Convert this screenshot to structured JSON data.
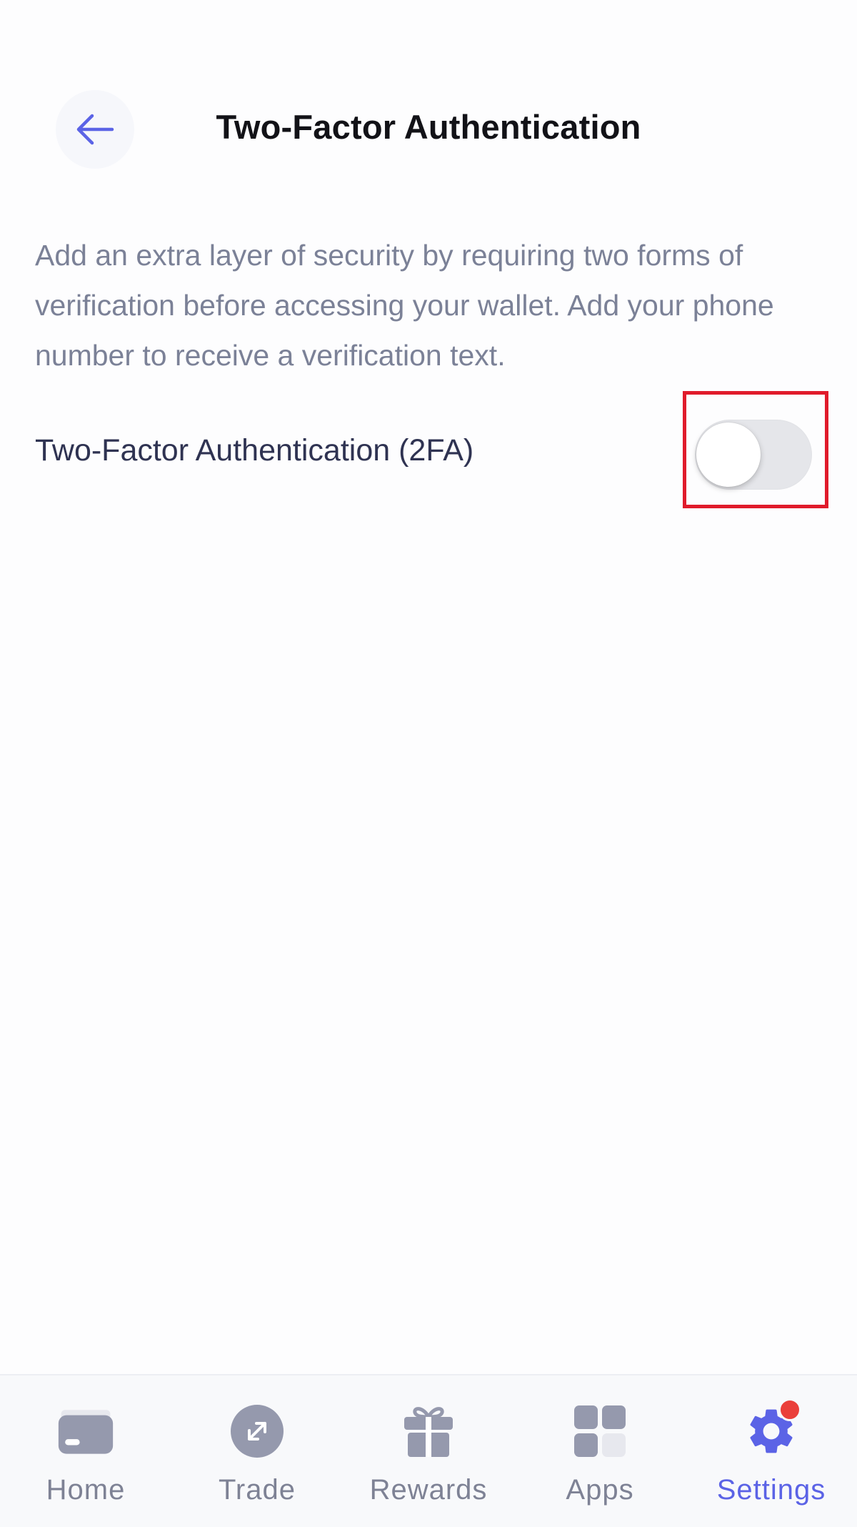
{
  "header": {
    "back_icon": "arrow-left-icon",
    "title": "Two-Factor Authentication"
  },
  "content": {
    "description": "Add an extra layer of security by requiring two forms of verification before accessing your wallet. Add your phone number to receive a verification text.",
    "setting_label": "Two-Factor Authentication (2FA)",
    "toggle_state": "off"
  },
  "nav": {
    "items": [
      {
        "label": "Home",
        "icon": "wallet-card-icon",
        "active": false
      },
      {
        "label": "Trade",
        "icon": "trade-arrows-icon",
        "active": false
      },
      {
        "label": "Rewards",
        "icon": "gift-icon",
        "active": false
      },
      {
        "label": "Apps",
        "icon": "apps-grid-icon",
        "active": false
      },
      {
        "label": "Settings",
        "icon": "gear-icon",
        "active": true
      }
    ]
  },
  "colors": {
    "accent": "#5b63e6",
    "highlight": "#e01b2b",
    "badge": "#ea3f3a",
    "nav_icon": "#9599ad"
  }
}
